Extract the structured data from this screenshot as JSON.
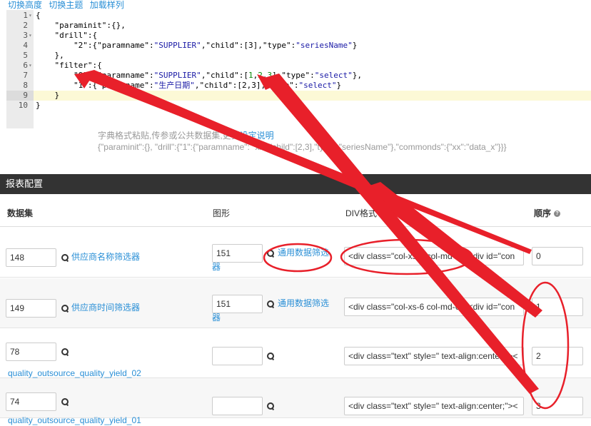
{
  "toolbar": {
    "switch_height": "切换高度",
    "switch_theme": "切换主题",
    "load_sample": "加载样列"
  },
  "editor": {
    "lines": [
      {
        "n": "1",
        "fold": true
      },
      {
        "n": "2"
      },
      {
        "n": "3",
        "fold": true
      },
      {
        "n": "4"
      },
      {
        "n": "5"
      },
      {
        "n": "6",
        "fold": true
      },
      {
        "n": "7"
      },
      {
        "n": "8"
      },
      {
        "n": "9"
      },
      {
        "n": "10"
      }
    ]
  },
  "hint": {
    "text": "字典格式粘贴,传参或公共数据集,更多",
    "link": "设定说明",
    "example": "{\"paraminit\":{}, \"drill\":{\"1\":{\"paramname\": \"xx\",\"child\":[2,3],\"type\":\"seriesName\"},\"commonds\":{\"xx\":\"data_x\"}}}"
  },
  "panel": {
    "title": "报表配置"
  },
  "columns": {
    "dataset": "数据集",
    "graph": "图形",
    "div": "DIV格式",
    "order": "顺序"
  },
  "rows": [
    {
      "dataset_id": "148",
      "dataset_link": "供应商名称筛选器",
      "graph_id": "151",
      "graph_link": "通用数据筛选器",
      "div": "<div class=\"col-xs-6 col-md-6\"><div id=\"con",
      "order": "0"
    },
    {
      "dataset_id": "149",
      "dataset_link": "供应商时间筛选器",
      "graph_id": "151",
      "graph_link": "通用数据筛选器",
      "div": "<div class=\"col-xs-6 col-md-6\"><div id=\"con",
      "order": "1"
    },
    {
      "dataset_id": "78",
      "dataset_link": "quality_outsource_quality_yield_02",
      "graph_id": "",
      "graph_link": "",
      "div": "<div class=\"text\" style=\" text-align:center;\"><",
      "order": "2"
    },
    {
      "dataset_id": "74",
      "dataset_link": "quality_outsource_quality_yield_01",
      "graph_id": "",
      "graph_link": "",
      "div": "<div class=\"text\" style=\" text-align:center;\"><",
      "order": "3"
    }
  ],
  "colors": {
    "link": "#2a8fd6",
    "annotation": "#e8202a",
    "header_bg": "#333333"
  }
}
